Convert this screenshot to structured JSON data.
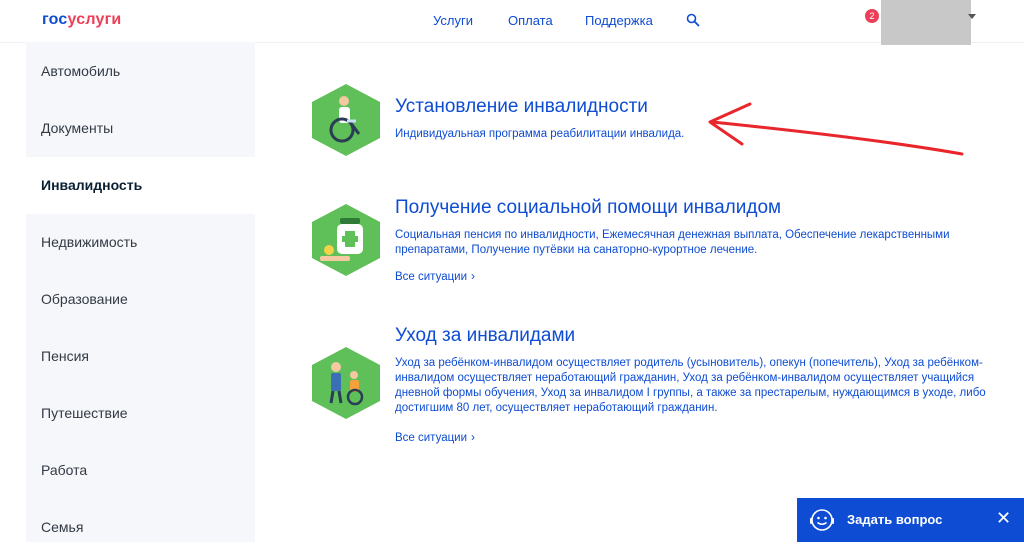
{
  "header": {
    "logo_part1": "гос",
    "logo_part2": "услуги",
    "nav": [
      "Услуги",
      "Оплата",
      "Поддержка"
    ],
    "notification_count": "2"
  },
  "sidebar": {
    "items": [
      {
        "label": "Автомобиль"
      },
      {
        "label": "Документы"
      },
      {
        "label": "Инвалидность",
        "active": true
      },
      {
        "label": "Недвижимость"
      },
      {
        "label": "Образование"
      },
      {
        "label": "Пенсия"
      },
      {
        "label": "Путешествие"
      },
      {
        "label": "Работа"
      },
      {
        "label": "Семья"
      }
    ]
  },
  "sections": [
    {
      "title": "Установление инвалидности",
      "description": "Индивидуальная программа реабилитации инвалида."
    },
    {
      "title": "Получение социальной помощи инвалидом",
      "description": "Социальная пенсия по инвалидности, Ежемесячная денежная выплата, Обеспечение лекарственными препаратами, Получение путёвки на санаторно-курортное лечение.",
      "link": "Все ситуации"
    },
    {
      "title": "Уход за инвалидами",
      "description": "Уход за ребёнком-инвалидом осуществляет родитель (усыновитель), опекун (попечитель), Уход за ребёнком-инвалидом осуществляет неработающий гражданин, Уход за ребёнком-инвалидом осуществляет учащийся дневной формы обучения, Уход за инвалидом I группы, а также за престарелым, нуждающимся в уходе, либо достигшим 80 лет, осуществляет неработающий гражданин.",
      "link": "Все ситуации"
    }
  ],
  "ask_widget": {
    "label": "Задать вопрос",
    "close": "✕"
  },
  "colors": {
    "brand_blue": "#0d4cd3",
    "brand_red": "#ee3f58",
    "icon_green": "#5fbf58",
    "annotation_red": "#e8262b"
  }
}
